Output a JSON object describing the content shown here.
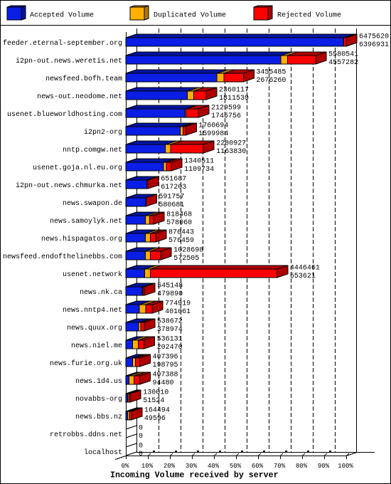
{
  "chart_data": {
    "type": "bar",
    "orientation": "horizontal",
    "stacked": true,
    "three_d": true,
    "title": "",
    "xlabel": "Incoming Volume received by server",
    "ylabel": "",
    "xlim": [
      0,
      100
    ],
    "x_unit": "percent of largest server total",
    "scale_max": 6475620,
    "x_ticks": [
      "0%",
      "10%",
      "20%",
      "30%",
      "40%",
      "50%",
      "60%",
      "70%",
      "80%",
      "90%",
      "100%"
    ],
    "grid": true,
    "legend_position": "top",
    "categories": [
      "feeder.eternal-september.org",
      "i2pn-out.news.weretis.net",
      "newsfeed.bofh.team",
      "news-out.neodome.net",
      "usenet.blueworldhosting.com",
      "i2pn2-org",
      "nntp.comgw.net",
      "usenet.goja.nl.eu.org",
      "i2pn-out.news.chmurka.net",
      "news.swapon.de",
      "news.samoylyk.net",
      "news.hispagatos.org",
      "newsfeed.endofthelinebbs.com",
      "usenet.network",
      "news.nk.ca",
      "news.nntp4.net",
      "news.quux.org",
      "news.niel.me",
      "news.furie.org.uk",
      "news.1d4.us",
      "novabbs-org",
      "news.bbs.nz",
      "retrobbs.ddns.net",
      "localhost"
    ],
    "series": [
      {
        "name": "Accepted Volume",
        "color": "#0a1ee6",
        "shade_color": "#0014a0",
        "values": [
          6396931,
          4557282,
          2676260,
          1811539,
          1745756,
          1599984,
          1163830,
          1109734,
          617203,
          580681,
          578060,
          576459,
          572505,
          553621,
          479890,
          401061,
          378974,
          202470,
          198795,
          94480,
          51524,
          49596,
          0,
          0
        ]
      },
      {
        "name": "Duplicated Volume",
        "color": "#ffb000",
        "shade_color": "#b07800",
        "values": [
          5000,
          190000,
          210000,
          180000,
          30000,
          80000,
          157000,
          80000,
          0,
          0,
          120000,
          145000,
          146000,
          170000,
          25000,
          180000,
          60000,
          165000,
          84000,
          145000,
          30000,
          60000,
          0,
          0
        ]
      },
      {
        "name": "Rejected Volume",
        "color": "#ff0000",
        "shade_color": "#b00000",
        "values": [
          73689,
          833259,
          569225,
          368578,
          353843,
          80710,
          960097,
          150777,
          34484,
          11076,
          120408,
          154984,
          310193,
          3722840,
          40258,
          193858,
          99698,
          168661,
          124601,
          167908,
          48486,
          54898,
          0,
          0
        ]
      }
    ],
    "value_labels": [
      {
        "total": "6475620",
        "accepted": "6396931"
      },
      {
        "total": "5580541",
        "accepted": "4557282"
      },
      {
        "total": "3455485",
        "accepted": "2676260"
      },
      {
        "total": "2360117",
        "accepted": "1811539"
      },
      {
        "total": "2129599",
        "accepted": "1745756"
      },
      {
        "total": "1760694",
        "accepted": "1599984"
      },
      {
        "total": "2280927",
        "accepted": "1163830"
      },
      {
        "total": "1340511",
        "accepted": "1109734"
      },
      {
        "total": "651687",
        "accepted": "617203"
      },
      {
        "total": "591757",
        "accepted": "580681"
      },
      {
        "total": "818468",
        "accepted": "578060"
      },
      {
        "total": "876443",
        "accepted": "576459"
      },
      {
        "total": "1028698",
        "accepted": "572505"
      },
      {
        "total": "4446461",
        "accepted": "553621"
      },
      {
        "total": "545148",
        "accepted": "479890"
      },
      {
        "total": "774919",
        "accepted": "401061"
      },
      {
        "total": "538672",
        "accepted": "378974"
      },
      {
        "total": "536131",
        "accepted": "202470"
      },
      {
        "total": "407396",
        "accepted": "198795"
      },
      {
        "total": "407388",
        "accepted": "94480"
      },
      {
        "total": "130010",
        "accepted": "51524"
      },
      {
        "total": "164494",
        "accepted": "49596"
      },
      {
        "total": "0",
        "accepted": "0"
      },
      {
        "total": "0",
        "accepted": "0"
      }
    ]
  }
}
